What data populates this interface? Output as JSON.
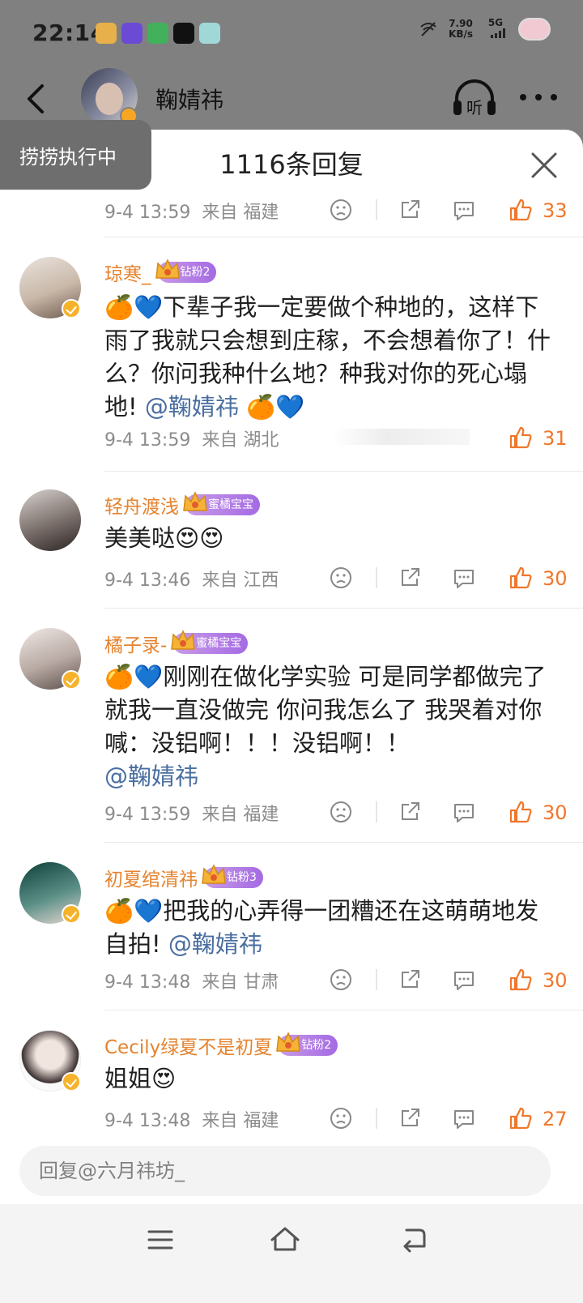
{
  "status_bar": {
    "time": "22:14",
    "net_speed_value": "7.90",
    "net_speed_unit": "KB/s",
    "network": "5G",
    "notification_icons": [
      "weibo-icon",
      "theme-app-icon",
      "video-app-icon",
      "smile-app-icon",
      "gallery-app-icon"
    ]
  },
  "header": {
    "author_name": "鞠婧祎"
  },
  "toast": {
    "text": "捞捞执行中"
  },
  "sheet": {
    "title": "1116条回复"
  },
  "top_meta": {
    "date": "9-4 13:59",
    "location": "来自 福建",
    "likes": "33"
  },
  "comments": [
    {
      "name": "琼寒_",
      "badge": "钻粉2",
      "emoji": "🍊💙",
      "text": "下辈子我一定要做个种地的，这样下雨了我就只会想到庄稼，不会想着你了！什么？你问我种什么地？种我对你的死心塌地! ",
      "mention": "@鞠婧祎",
      "suffix": " 🍊💙",
      "date": "9-4 13:59",
      "location": "来自 湖北",
      "likes": "31"
    },
    {
      "name": "轻舟渡浅",
      "badge": "蜜橘宝宝",
      "emoji": "",
      "text": "美美哒😍😍",
      "mention": "",
      "suffix": "",
      "date": "9-4 13:46",
      "location": "来自 江西",
      "likes": "30"
    },
    {
      "name": "橘子录-",
      "badge": "蜜橘宝宝",
      "emoji": "🍊💙",
      "text": "刚刚在做化学实验 可是同学都做完了 就我一直没做完 你问我怎么了 我哭着对你喊：没铝啊！！！没铝啊！！",
      "mention": "@鞠婧祎",
      "suffix": "",
      "date": "9-4 13:59",
      "location": "来自 福建",
      "likes": "30"
    },
    {
      "name": "初夏绾清祎",
      "badge": "钻粉3",
      "emoji": "🍊💙",
      "text": "把我的心弄得一团糟还在这萌萌地发自拍! ",
      "mention": "@鞠婧祎",
      "suffix": "",
      "date": "9-4 13:48",
      "location": "来自 甘肃",
      "likes": "30"
    },
    {
      "name": "Cecily绿夏不是初夏",
      "badge": "钻粉2",
      "emoji": "",
      "text": "姐姐😍",
      "mention": "",
      "suffix": "",
      "date": "9-4 13:48",
      "location": "来自 福建",
      "likes": "27"
    }
  ],
  "reply_bar": {
    "placeholder": "回复@六月祎坊_"
  },
  "colors": {
    "accent_orange": "#f0772b",
    "name_orange": "#e5832e",
    "mention_blue": "#4a6ea0",
    "dim_overlay": "#808080"
  }
}
